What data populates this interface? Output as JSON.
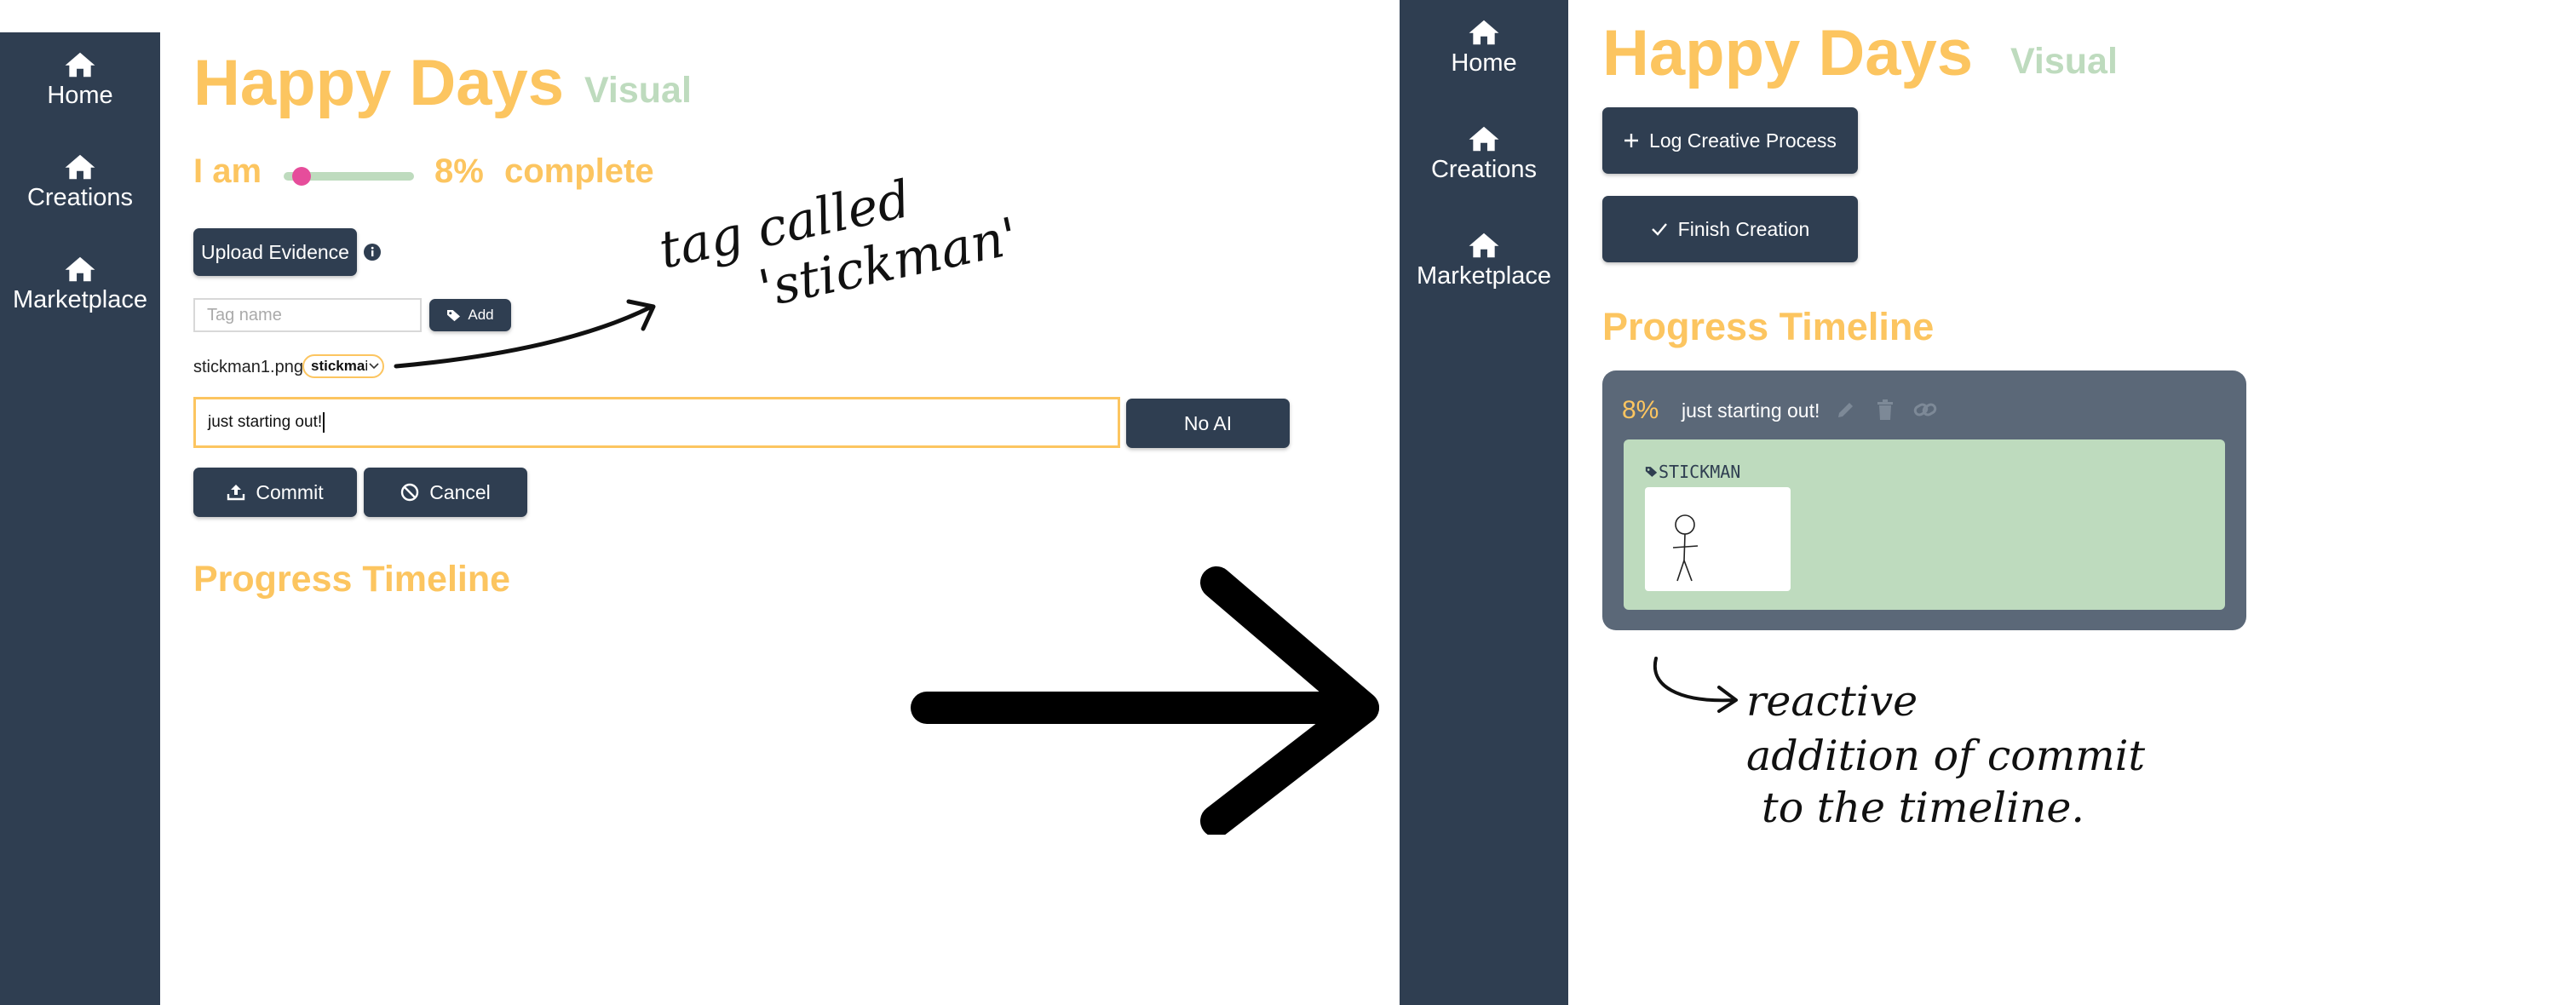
{
  "nav": {
    "home": "Home",
    "creations": "Creations",
    "marketplace": "Marketplace"
  },
  "left": {
    "title": "Happy Days",
    "subtitle": "Visual",
    "progress": {
      "prefix": "I am",
      "percent": "8%",
      "suffix": "complete",
      "value": 0.08
    },
    "upload_label": "Upload Evidence",
    "tag_input": {
      "placeholder": "Tag name"
    },
    "add_label": "Add",
    "file_name": "stickman1.png",
    "tag_chip": "stickmai",
    "message": "just starting out!",
    "noai_label": "No AI",
    "commit_label": "Commit",
    "cancel_label": "Cancel",
    "timeline_heading": "Progress Timeline"
  },
  "right": {
    "title": "Happy Days",
    "subtitle": "Visual",
    "log_label": "Log Creative Process",
    "finish_label": "Finish Creation",
    "timeline_heading": "Progress Timeline",
    "commit": {
      "percent": "8%",
      "message": "just starting out!",
      "tag": "STICKMAN"
    }
  },
  "annotations": {
    "tag_note_line1": "tag called",
    "tag_note_line2": "'stickman'",
    "reactive_line1": "reactive",
    "reactive_line2": "addition of commit",
    "reactive_line3": "to the timeline."
  },
  "colors": {
    "sidebar": "#2f3e51",
    "accent": "#fcc560",
    "pale_green": "#bedbbe",
    "slider_thumb": "#e64d9b",
    "card": "#5b6878"
  }
}
